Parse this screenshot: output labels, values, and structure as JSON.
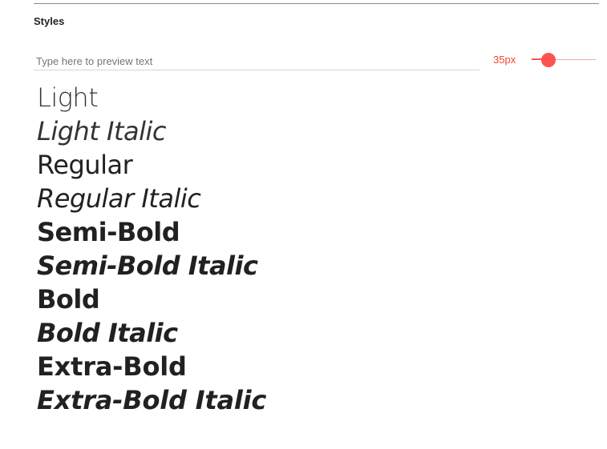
{
  "section": {
    "title": "Styles"
  },
  "preview": {
    "placeholder": "Type here to preview text",
    "value": ""
  },
  "size": {
    "label": "35px",
    "slider_fraction": 0.26
  },
  "styles": [
    {
      "label": "Light",
      "weight": 300,
      "italic": false
    },
    {
      "label": "Light Italic",
      "weight": 300,
      "italic": true
    },
    {
      "label": "Regular",
      "weight": 400,
      "italic": false
    },
    {
      "label": "Regular Italic",
      "weight": 400,
      "italic": true
    },
    {
      "label": "Semi-Bold",
      "weight": 600,
      "italic": false
    },
    {
      "label": "Semi-Bold Italic",
      "weight": 600,
      "italic": true
    },
    {
      "label": "Bold",
      "weight": 700,
      "italic": false
    },
    {
      "label": "Bold Italic",
      "weight": 700,
      "italic": true
    },
    {
      "label": "Extra-Bold",
      "weight": 800,
      "italic": false
    },
    {
      "label": "Extra-Bold Italic",
      "weight": 800,
      "italic": true
    }
  ],
  "colors": {
    "accent": "#ff5252",
    "text": "#212121"
  }
}
